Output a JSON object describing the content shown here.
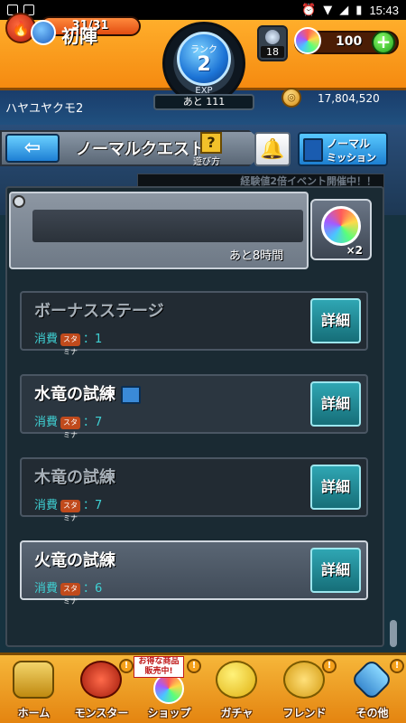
{
  "status_bar": {
    "time": "15:43"
  },
  "header": {
    "stamina": "31/31",
    "stamina_fraction": 1.0,
    "rank_label": "ランク",
    "rank": "2",
    "exp_label": "EXP",
    "exp_remaining": "あと 111",
    "gem_count": "18",
    "orb_count": "100",
    "plus_label": "+"
  },
  "player": {
    "name": "ハヤユヤクモ2",
    "coins": "17,804,520"
  },
  "quest_bar": {
    "back_arrow": "⇦",
    "title": "ノーマルクエスト",
    "help_icon": "?",
    "help_label": "遊び方",
    "mission_line1": "ノーマル",
    "mission_line2": "ミッション"
  },
  "event_banner": "経験値2倍イベント開催中！！",
  "featured": {
    "title": "初陣",
    "remaining": "あと8時間",
    "reward_multiplier": "×2"
  },
  "stages": [
    {
      "name": "ボーナスステージ",
      "cost_label": "消費",
      "stamina_word": "スタミナ",
      "cost": "：1",
      "detail_label": "詳細"
    },
    {
      "name": "水竜の試練",
      "cost_label": "消費",
      "stamina_word": "スタミナ",
      "cost": "：7",
      "detail_label": "詳細"
    },
    {
      "name": "木竜の試練",
      "cost_label": "消費",
      "stamina_word": "スタミナ",
      "cost": "：7",
      "detail_label": "詳細"
    },
    {
      "name": "火竜の試練",
      "cost_label": "消費",
      "stamina_word": "スタミナ",
      "cost": "：6",
      "detail_label": "詳細"
    }
  ],
  "promo_tag": {
    "line1": "お得な商品",
    "line2": "販売中!"
  },
  "bottom_nav": [
    {
      "label": "ホーム",
      "badge": ""
    },
    {
      "label": "モンスター",
      "badge": "!"
    },
    {
      "label": "ショップ",
      "badge": "!"
    },
    {
      "label": "ガチャ",
      "badge": ""
    },
    {
      "label": "フレンド",
      "badge": "!"
    },
    {
      "label": "その他",
      "badge": "!"
    }
  ]
}
